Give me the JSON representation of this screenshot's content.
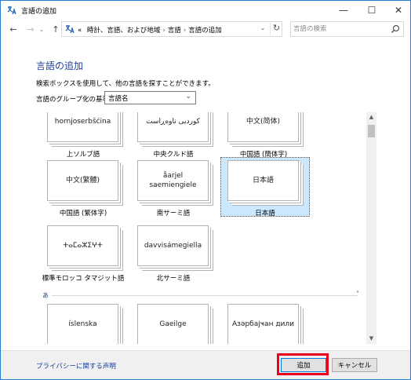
{
  "window": {
    "title": "言語の追加",
    "minimize": "—",
    "maximize": "☐",
    "close": "✕"
  },
  "nav": {
    "back": "←",
    "forward": "→",
    "history": "⌄",
    "up": "↑",
    "breadcrumb_prefix": "«",
    "breadcrumb": [
      "時計、言語、および地域",
      "言語",
      "言語の追加"
    ],
    "separator": "›",
    "address_dropdown": "⌄",
    "refresh": "↻",
    "search_placeholder": "言語の検索"
  },
  "content": {
    "heading": "言語の追加",
    "description": "検索ボックスを使用して、他の言語を探すことができます。",
    "group_label": "言語のグループ化の基準:",
    "group_value": "言語名",
    "group_chevron": "⌄"
  },
  "tiles": [
    {
      "text": "hornjoserbšćina",
      "label": "上ソルブ語"
    },
    {
      "text": "كوردیی ناوەڕاست",
      "label": "中央クルド語"
    },
    {
      "text": "中文(简体)",
      "label": "中国語 (簡体字)"
    },
    {
      "text": "中文(繁體)",
      "label": "中国語 (繁体字)"
    },
    {
      "text": "åarjel saemiengiele",
      "label": "南サーミ語"
    },
    {
      "text": "日本語",
      "label": "日本語"
    },
    {
      "text": "ⵜⴰⵎⴰⵣⵉⵖⵜ",
      "label": "標準モロッコ タマジット語"
    },
    {
      "text": "davvisámegiella",
      "label": "北サーミ語"
    },
    {
      "text": "íslenska",
      "label": ""
    },
    {
      "text": "Gaeilge",
      "label": ""
    },
    {
      "text": "Азәрбајҹан дили",
      "label": ""
    }
  ],
  "section": {
    "letter": "あ",
    "caret": "˄"
  },
  "scrollbar": {
    "up": "▲",
    "down": "▼"
  },
  "footer": {
    "privacy": "プライバシーに関する声明",
    "add": "追加",
    "cancel": "キャンセル"
  },
  "colors": {
    "accent": "#1e3f96",
    "selected_tile": "#cce8ff",
    "highlight": "#e8001c"
  }
}
